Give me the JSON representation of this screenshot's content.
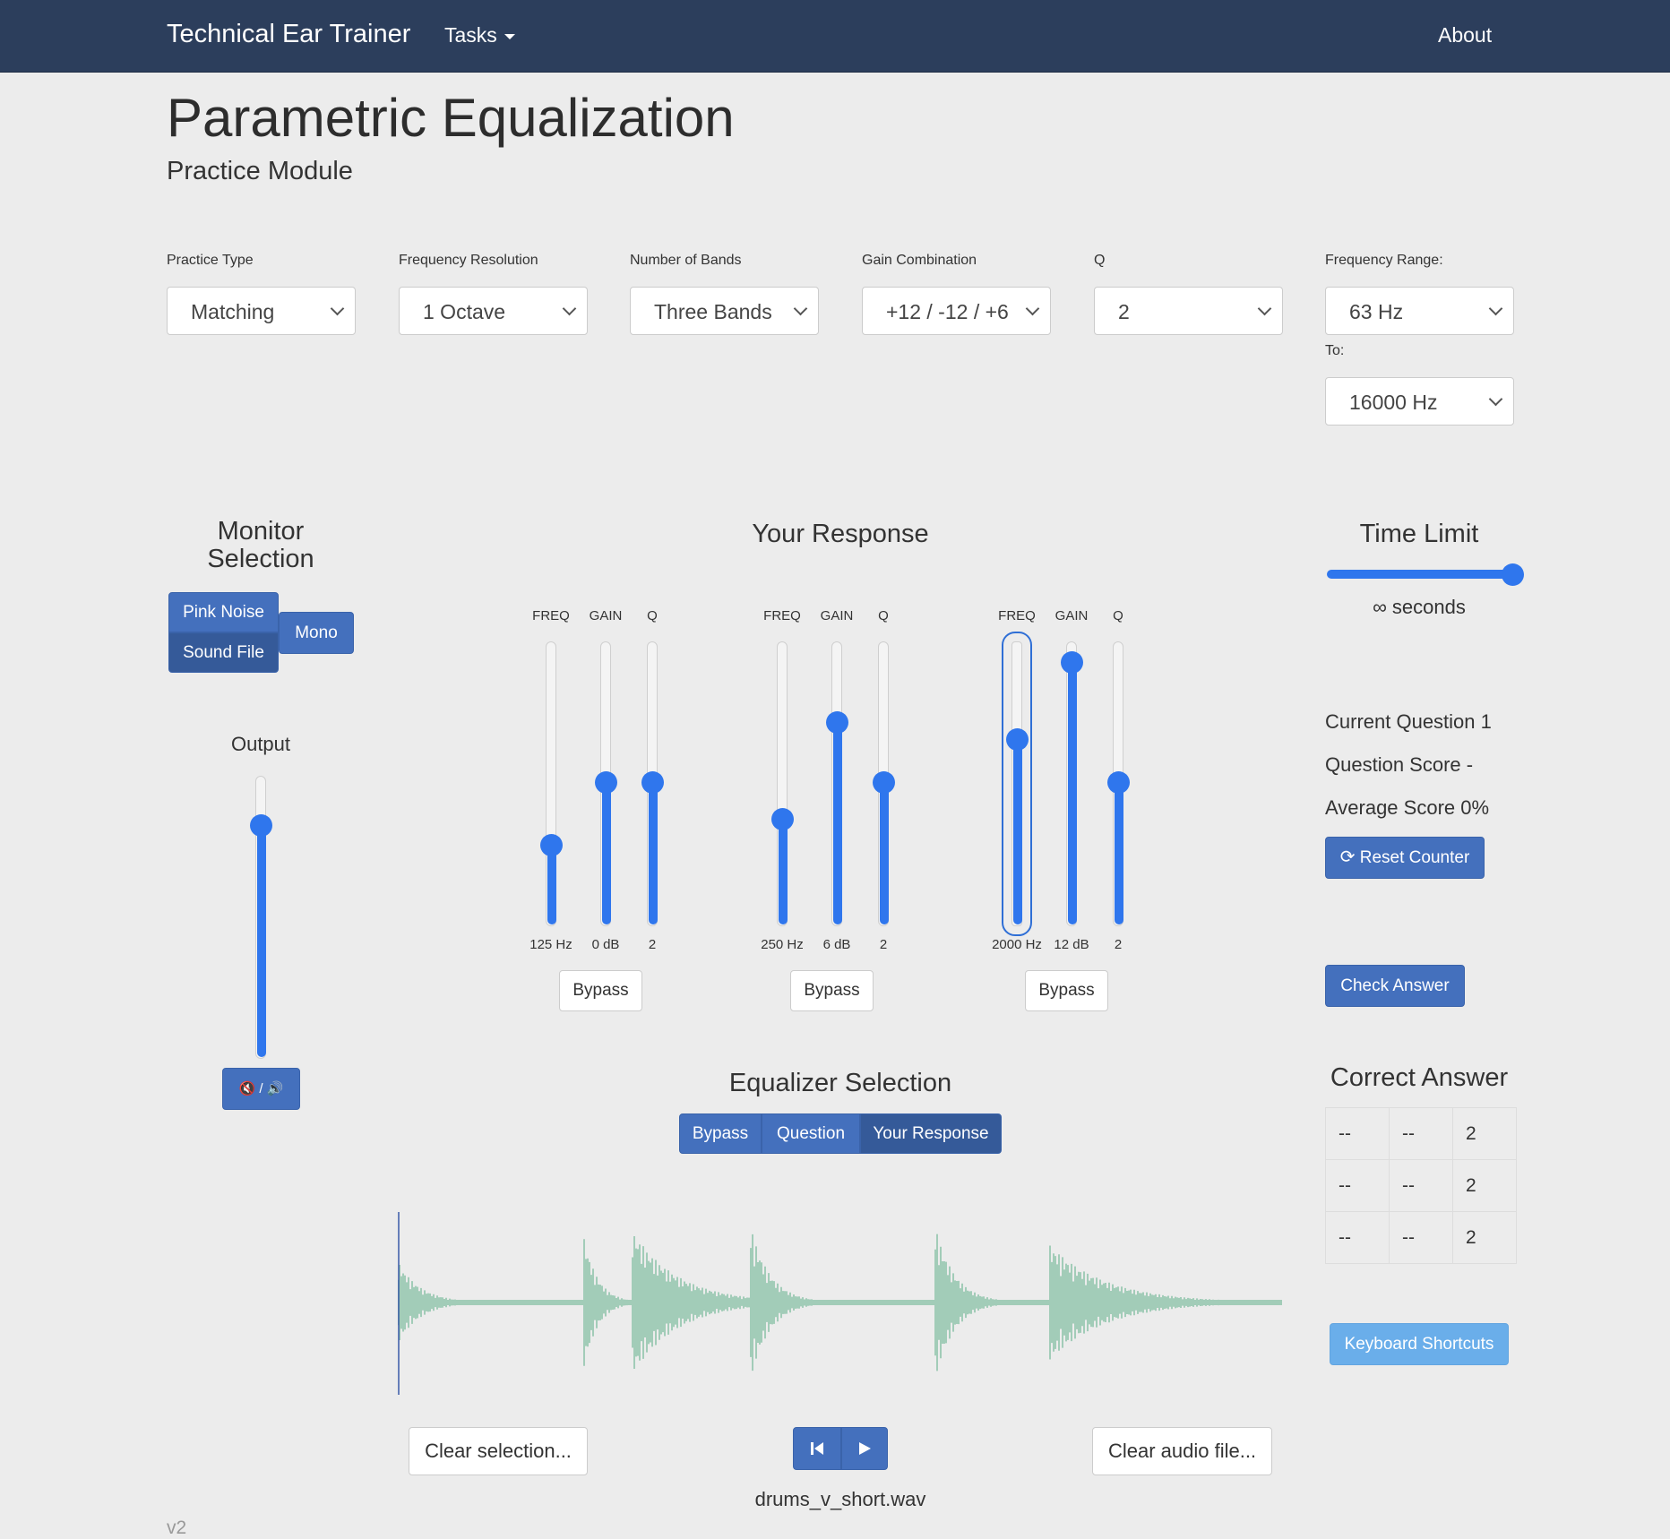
{
  "nav": {
    "brand": "Technical Ear Trainer",
    "tasks": "Tasks",
    "about": "About"
  },
  "page": {
    "title": "Parametric Equalization",
    "subtitle": "Practice Module"
  },
  "settings": {
    "practice_type": {
      "label": "Practice Type",
      "value": "Matching"
    },
    "frequency_resolution": {
      "label": "Frequency Resolution",
      "value": "1 Octave"
    },
    "number_of_bands": {
      "label": "Number of Bands",
      "value": "Three Bands"
    },
    "gain_combination": {
      "label": "Gain Combination",
      "value": "+12 / -12 / +6"
    },
    "q": {
      "label": "Q",
      "value": "2"
    },
    "frequency_range": {
      "label": "Frequency Range:",
      "from": "63 Hz",
      "to_label": "To:",
      "to": "16000 Hz"
    }
  },
  "monitor": {
    "title": "Monitor Selection",
    "pink_noise": "Pink Noise",
    "sound_file": "Sound File",
    "mono": "Mono",
    "output_label": "Output",
    "output_level": 0.82,
    "mute_button": "🔇 / 🔊"
  },
  "response": {
    "title": "Your Response",
    "freq_label": "FREQ",
    "gain_label": "GAIN",
    "q_label": "Q",
    "bypass_label": "Bypass",
    "bands": [
      {
        "freq": "125 Hz",
        "gain": "0 dB",
        "q": "2",
        "freq_level": 0.28,
        "gain_level": 0.5,
        "q_level": 0.5
      },
      {
        "freq": "250 Hz",
        "gain": "6 dB",
        "q": "2",
        "freq_level": 0.37,
        "gain_level": 0.71,
        "q_level": 0.5
      },
      {
        "freq": "2000 Hz",
        "gain": "12 dB",
        "q": "2",
        "freq_level": 0.65,
        "gain_level": 0.92,
        "q_level": 0.5
      }
    ]
  },
  "equalizer": {
    "title": "Equalizer Selection",
    "bypass": "Bypass",
    "question": "Question",
    "your_response": "Your Response"
  },
  "player": {
    "clear_selection": "Clear selection...",
    "clear_audio": "Clear audio file...",
    "filename": "drums_v_short.wav",
    "waveform_color": "#8fc4ab"
  },
  "time_limit": {
    "title": "Time Limit",
    "value": "∞ seconds",
    "level": 1.0
  },
  "score": {
    "current_question": "Current Question 1",
    "question_score": "Question Score -",
    "average_score": "Average Score 0%",
    "reset_button": "Reset Counter",
    "check_answer": "Check Answer"
  },
  "correct_answer": {
    "title": "Correct Answer",
    "rows": [
      [
        "--",
        "--",
        "2"
      ],
      [
        "--",
        "--",
        "2"
      ],
      [
        "--",
        "--",
        "2"
      ]
    ]
  },
  "keyboard_shortcuts": "Keyboard Shortcuts",
  "version": "v2",
  "colors": {
    "accent": "#2f76ed",
    "button": "#4470bd",
    "navbar": "#2c3e5c"
  }
}
